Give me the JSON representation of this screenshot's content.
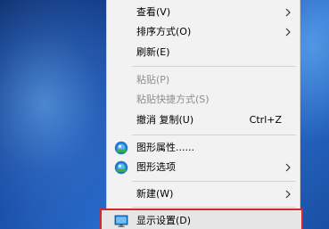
{
  "context_menu": {
    "items": [
      {
        "label": "查看(V)",
        "submenu": true
      },
      {
        "label": "排序方式(O)",
        "submenu": true
      },
      {
        "label": "刷新(E)"
      },
      {
        "label": "粘贴(P)",
        "disabled": true
      },
      {
        "label": "粘贴快捷方式(S)",
        "disabled": true
      },
      {
        "label": "撤消 复制(U)",
        "shortcut": "Ctrl+Z"
      },
      {
        "label": "图形属性......",
        "icon": "intel-graphics-icon"
      },
      {
        "label": "图形选项",
        "icon": "intel-graphics-icon",
        "submenu": true
      },
      {
        "label": "新建(W)",
        "submenu": true
      },
      {
        "label": "显示设置(D)",
        "icon": "display-settings-icon",
        "highlighted": true
      }
    ]
  },
  "colors": {
    "menu_background": "#f2f2f2",
    "highlight_border": "#d6282a",
    "disabled_text": "#8d8d8d",
    "desktop_blue": "#1b4ea8"
  }
}
